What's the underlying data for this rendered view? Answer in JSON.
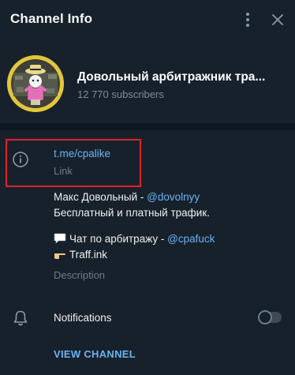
{
  "header": {
    "title": "Channel Info",
    "menu_icon": "more-vertical-icon",
    "close_icon": "close-icon"
  },
  "profile": {
    "name": "Довольный арбитражник тра...",
    "subscribers": "12 770 subscribers"
  },
  "link": {
    "value": "t.me/cpalike",
    "label": "Link"
  },
  "description": {
    "line1_text": "Макс Довольный - ",
    "line1_mention": "@dovolnyy",
    "line2": "Бесплатный и платный трафик.",
    "line3_text": "Чат по арбитражу - ",
    "line3_mention": "@cpafuck",
    "line4": "Traff.ink",
    "label": "Description"
  },
  "notifications": {
    "label": "Notifications",
    "enabled": false
  },
  "actions": {
    "view_channel": "VIEW CHANNEL"
  },
  "colors": {
    "background": "#17212b",
    "accent": "#6ab3f3",
    "highlight_border": "#e0202b"
  }
}
